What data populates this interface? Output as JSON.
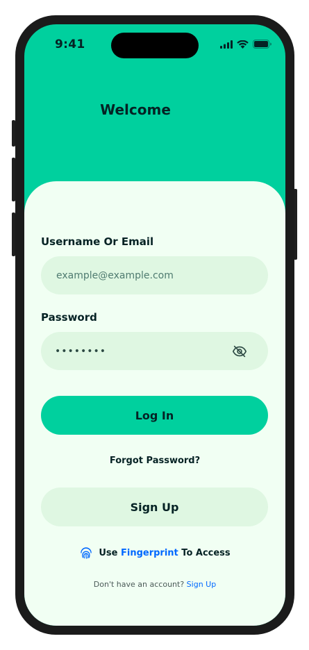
{
  "status_bar": {
    "time": "9:41"
  },
  "header": {
    "title": "Welcome"
  },
  "form": {
    "username_label": "Username Or Email",
    "username_placeholder": "example@example.com",
    "password_label": "Password",
    "password_value": "••••••••"
  },
  "actions": {
    "login_label": "Log In",
    "forgot_label": "Forgot Password?",
    "signup_label": "Sign Up"
  },
  "fingerprint": {
    "prefix": "Use",
    "accent": "Fingerprint",
    "suffix": "To Access"
  },
  "footer": {
    "question": "Don't have an account?",
    "link": "Sign Up"
  },
  "colors": {
    "primary": "#00D09E",
    "sheet_background": "#F1FFF3",
    "field_background": "#DFF7E2",
    "text_dark": "#052224",
    "link_blue": "#0068FF"
  },
  "icons": {
    "status": [
      "cellular-signal-icon",
      "wifi-icon",
      "battery-icon"
    ],
    "password_toggle": "eye-off-icon",
    "fingerprint": "fingerprint-icon"
  }
}
